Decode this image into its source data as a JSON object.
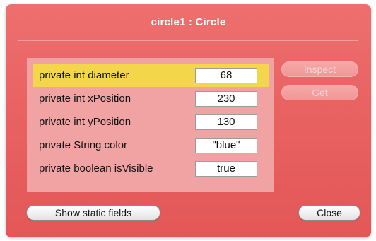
{
  "window": {
    "title": "circle1 : Circle"
  },
  "fields": [
    {
      "label": "private int diameter",
      "value": "68",
      "selected": true
    },
    {
      "label": "private int xPosition",
      "value": "230",
      "selected": false
    },
    {
      "label": "private int yPosition",
      "value": "130",
      "selected": false
    },
    {
      "label": "private String color",
      "value": "\"blue\"",
      "selected": false
    },
    {
      "label": "private boolean isVisible",
      "value": "true",
      "selected": false
    }
  ],
  "buttons": {
    "inspect": "Inspect",
    "get": "Get",
    "show_static_fields": "Show static fields",
    "close": "Close"
  },
  "colors": {
    "window_background": "#e96262",
    "fields_panel": "#f1a3a3",
    "selected_row": "#f4d64a"
  }
}
